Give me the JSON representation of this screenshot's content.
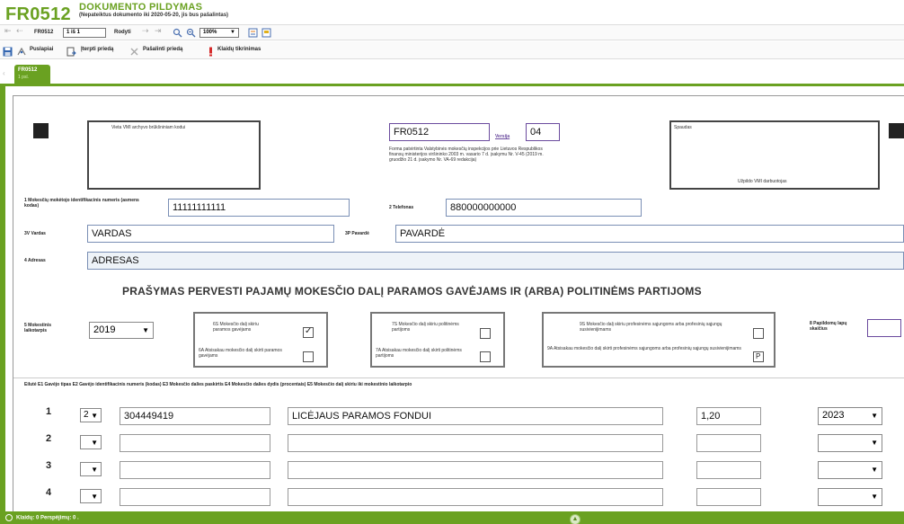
{
  "header": {
    "code": "FR0512",
    "title": "DOKUMENTO PILDYMAS",
    "subtitle": "(Nepateiktus dokumento iki 2020-05-20, jis bus pašalintas)"
  },
  "toolbar1": {
    "form_code": "FR0512",
    "page_field": "1 iš 1",
    "show_label": "Rodyti",
    "zoom": "100%"
  },
  "toolbar2": {
    "pages_label": "Puslapiai",
    "insert_label": "Įterpti priedą",
    "remove_label": "Pašalinti priedą",
    "errors_label": "Klaidų tikrinimas"
  },
  "tab": {
    "title": "FR0512",
    "sub": "1 psl."
  },
  "form": {
    "vmi_box_label": "Vieta VMI archyvo brūkšniniam kodui",
    "form_code": "FR0512",
    "version_label": "Versija",
    "version_value": "04",
    "approval_text": "Forma patvirtinta Valstybinės mokesčių inspekcijos prie Lietuvos Respublikos finansų ministerijos viršininko 2003 m. vasario 7 d. įsakymu Nr. V-45 (2019 m. gruodžio 21 d. įsakymo Nr. VA-69 redakcija)",
    "stamp_label": "Spaudas",
    "stamp_footer": "Užpildo VMI darbuotojas",
    "tax_id_label": "1 Mokesčių mokėtojo identifikacinis numeris (asmens kodas)",
    "tax_id_value": "11111111111",
    "phone_label": "2 Telefonas",
    "phone_value": "880000000000",
    "first_name_label": "3V Vardas",
    "first_name_value": "VARDAS",
    "last_name_label": "3P Pavardė",
    "last_name_value": "PAVARDĖ",
    "address_label": "4 Adresas",
    "address_value": "ADRESAS",
    "heading": "PRAŠYMAS PERVESTI PAJAMŲ MOKESČIO DALĮ PARAMOS GAVĖJAMS IR (ARBA) POLITINĖMS PARTIJOMS",
    "period_label": "5 Mokestinis laikotarpis",
    "period_value": "2019",
    "g6s": "6S Mokesčio dalį skiriu paramos gavėjams",
    "g6a": "6A Atsisakau mokesčio dalį skirti paramos gavėjams",
    "g7s": "7S Mokesčio dalį skiriu politinėms partijoms",
    "g7a": "7A Atsisakau mokesčio dalį skirti politinėms partijoms",
    "g9s": "9S Mokesčio dalį skiriu profesinėms sąjungoms arba profesinių sąjungų susivienijimams",
    "g9a": "9A Atsisakau mokesčio dalį skirti profesinėms sąjungoms arba profesinių sąjungų susivienijimams",
    "pages_count_label": "8 Papildomų lapų skaičius",
    "columns_label": "Eilutė E1 Gavėjo tipas E2 Gavėjo identifikacinis numeris (kodas) E3 Mokesčio dalies paskirtis E4 Mokesčio dalies dydis (procentais) E5 Mokesčio dalį skiriu iki mokestinio laikotarpio"
  },
  "rows": [
    {
      "num": "1",
      "type": "2",
      "code": "304449419",
      "name": "LICĖJAUS PARAMOS FONDUI",
      "percent": "1,20",
      "year": "2023"
    },
    {
      "num": "2",
      "type": "",
      "code": "",
      "name": "",
      "percent": "",
      "year": ""
    },
    {
      "num": "3",
      "type": "",
      "code": "",
      "name": "",
      "percent": "",
      "year": ""
    },
    {
      "num": "4",
      "type": "",
      "code": "",
      "name": "",
      "percent": "",
      "year": ""
    }
  ],
  "status": {
    "text": "Klaidų: 0 Perspėjimų: 0 ."
  },
  "colors": {
    "accent": "#6aa121",
    "field_border": "#6b4b9e"
  }
}
